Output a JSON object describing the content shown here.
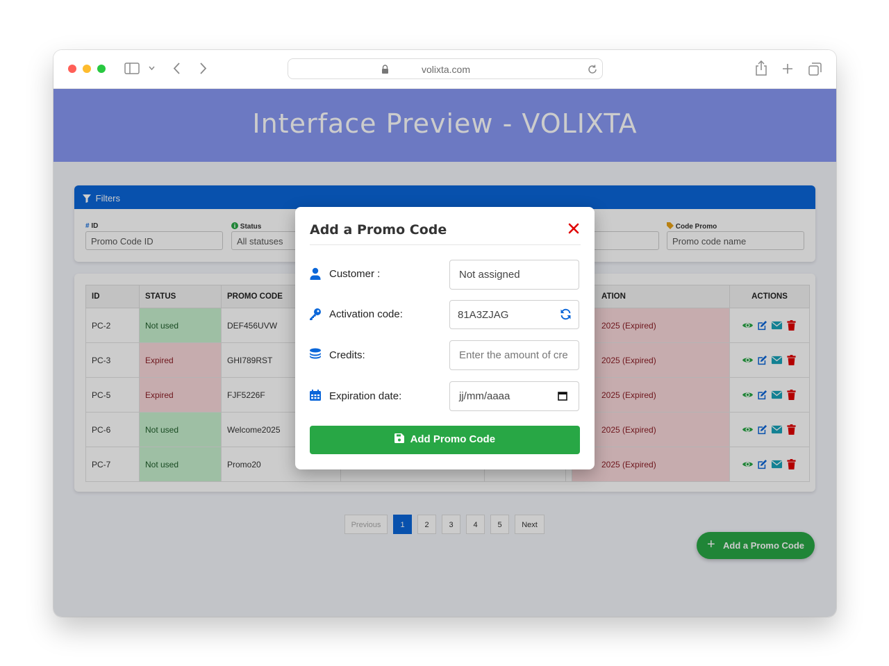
{
  "browser": {
    "url": "volixta.com"
  },
  "page": {
    "title": "Interface Preview - VOLIXTA"
  },
  "filters": {
    "header": "Filters",
    "fields": [
      {
        "label": "ID",
        "placeholder": "Promo Code ID"
      },
      {
        "label": "Status",
        "value": "All statuses"
      },
      {
        "label": "Code Promo",
        "placeholder": "Promo code name"
      }
    ]
  },
  "table": {
    "headers": [
      "ID",
      "STATUS",
      "PROMO CODE",
      "",
      "",
      "",
      "ATION",
      "ACTIONS"
    ],
    "rows": [
      {
        "id": "PC-2",
        "status": "Not used",
        "code": "DEF456UVW",
        "expiration": "2025 (Expired)"
      },
      {
        "id": "PC-3",
        "status": "Expired",
        "code": "GHI789RST",
        "expiration": "2025 (Expired)"
      },
      {
        "id": "PC-5",
        "status": "Expired",
        "code": "FJF5226F",
        "expiration": "2025 (Expired)"
      },
      {
        "id": "PC-6",
        "status": "Not used",
        "code": "Welcome2025",
        "expiration": "2025 (Expired)"
      },
      {
        "id": "PC-7",
        "status": "Not used",
        "code": "Promo20",
        "expiration": "2025 (Expired)"
      }
    ]
  },
  "pagination": {
    "previous": "Previous",
    "pages": [
      "1",
      "2",
      "3",
      "4",
      "5"
    ],
    "active": "1",
    "next": "Next"
  },
  "fab": {
    "label": "Add a Promo Code"
  },
  "modal": {
    "title": "Add a Promo Code",
    "customer_label": "Customer :",
    "customer_value": "Not assigned",
    "activation_label": "Activation code:",
    "activation_value": "81A3ZJAG",
    "credits_label": "Credits:",
    "credits_placeholder": "Enter the amount of cre",
    "expiration_label": "Expiration date:",
    "expiration_placeholder": "jj/mm/aaaa",
    "submit_label": "Add Promo Code"
  },
  "colors": {
    "banner": "#8798f3",
    "primary": "#0a66d9",
    "success": "#28a745",
    "danger": "#e00000",
    "status_not_used_bg": "#c6efce",
    "status_expired_bg": "#f8d7da"
  }
}
